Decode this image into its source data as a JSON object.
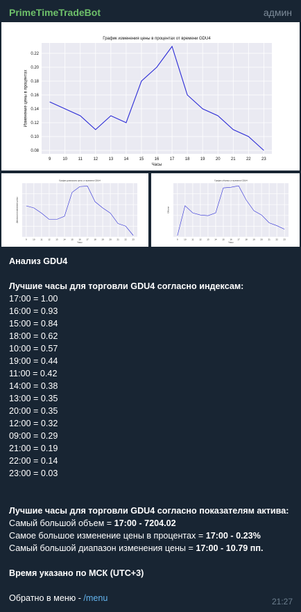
{
  "header": {
    "sender": "PrimeTimeTradeBot",
    "role": "админ"
  },
  "colors": {
    "background": "#182533",
    "sender": "#6ec06a",
    "link": "#64b5ef",
    "plot_bg": "#eaeaf2",
    "line": "#2b2bd6"
  },
  "chart_data": [
    {
      "type": "line",
      "title": "График изменения цены в процентах от времени GDU4",
      "xlabel": "Часы",
      "ylabel": "Изменение цены в процентах",
      "x": [
        9,
        10,
        11,
        12,
        13,
        14,
        15,
        16,
        17,
        18,
        19,
        20,
        21,
        22,
        23
      ],
      "series": [
        {
          "values": [
            0.15,
            0.14,
            0.13,
            0.11,
            0.13,
            0.12,
            0.18,
            0.2,
            0.23,
            0.16,
            0.14,
            0.13,
            0.11,
            0.1,
            0.08
          ]
        }
      ],
      "yticks": [
        "0.08",
        "0.10",
        "0.12",
        "0.14",
        "0.16",
        "0.18",
        "0.20",
        "0.22"
      ],
      "ylim": [
        0.075,
        0.235
      ]
    },
    {
      "type": "line",
      "title": "График диапазона цены от времени GDU4",
      "xlabel": "Часы",
      "ylabel": "Диапазон изменения цены",
      "x": [
        9,
        10,
        11,
        12,
        13,
        14,
        15,
        16,
        17,
        18,
        19,
        20,
        21,
        22,
        23
      ],
      "series": [
        {
          "values": [
            7.0,
            6.6,
            5.6,
            4.4,
            4.4,
            5.0,
            9.6,
            10.7,
            10.8,
            7.8,
            6.6,
            5.6,
            3.6,
            3.1,
            1.3
          ]
        }
      ],
      "ylim": [
        1.0,
        11.4
      ],
      "grid": true
    },
    {
      "type": "line",
      "title": "График объема от времени GDU4",
      "xlabel": "Часы",
      "ylabel": "Объем",
      "x": [
        9,
        10,
        11,
        12,
        13,
        14,
        15,
        16,
        17,
        18,
        19,
        20,
        21,
        22,
        23
      ],
      "series": [
        {
          "values": [
            200,
            4400,
            3400,
            3100,
            3000,
            3400,
            6900,
            7000,
            7200,
            5200,
            3700,
            3100,
            2000,
            1600,
            1100
          ]
        }
      ],
      "ylim": [
        0,
        7600
      ],
      "grid": true
    }
  ],
  "message": {
    "title": "Анализ GDU4",
    "indices_header": "Лучшие часы для торговли GDU4 согласно индексам:",
    "indices": [
      "17:00 = 1.00",
      "16:00 = 0.93",
      "15:00 = 0.84",
      "18:00 = 0.62",
      "10:00 = 0.57",
      "19:00 = 0.44",
      "11:00 = 0.42",
      "14:00 = 0.38",
      "13:00 = 0.35",
      "20:00 = 0.35",
      "12:00 = 0.32",
      "09:00 = 0.29",
      "21:00 = 0.19",
      "22:00 = 0.14",
      "23:00 = 0.03"
    ],
    "metrics_header": "Лучшие часы для торговли GDU4 согласно показателям актива:",
    "volume_label": "Самый большой объем = ",
    "volume_value": "17:00 - 7204.02",
    "change_label": "Самое большое изменение цены в процентах = ",
    "change_value": "17:00 - 0.23%",
    "range_label": "Самый большой диапазон изменения цены = ",
    "range_value": "17:00 - 10.79 пп.",
    "timezone_note": "Время указано по МСК (UTC+3)",
    "menu_text": "Обратно в меню - ",
    "menu_command": "/menu",
    "time": "21:27"
  }
}
